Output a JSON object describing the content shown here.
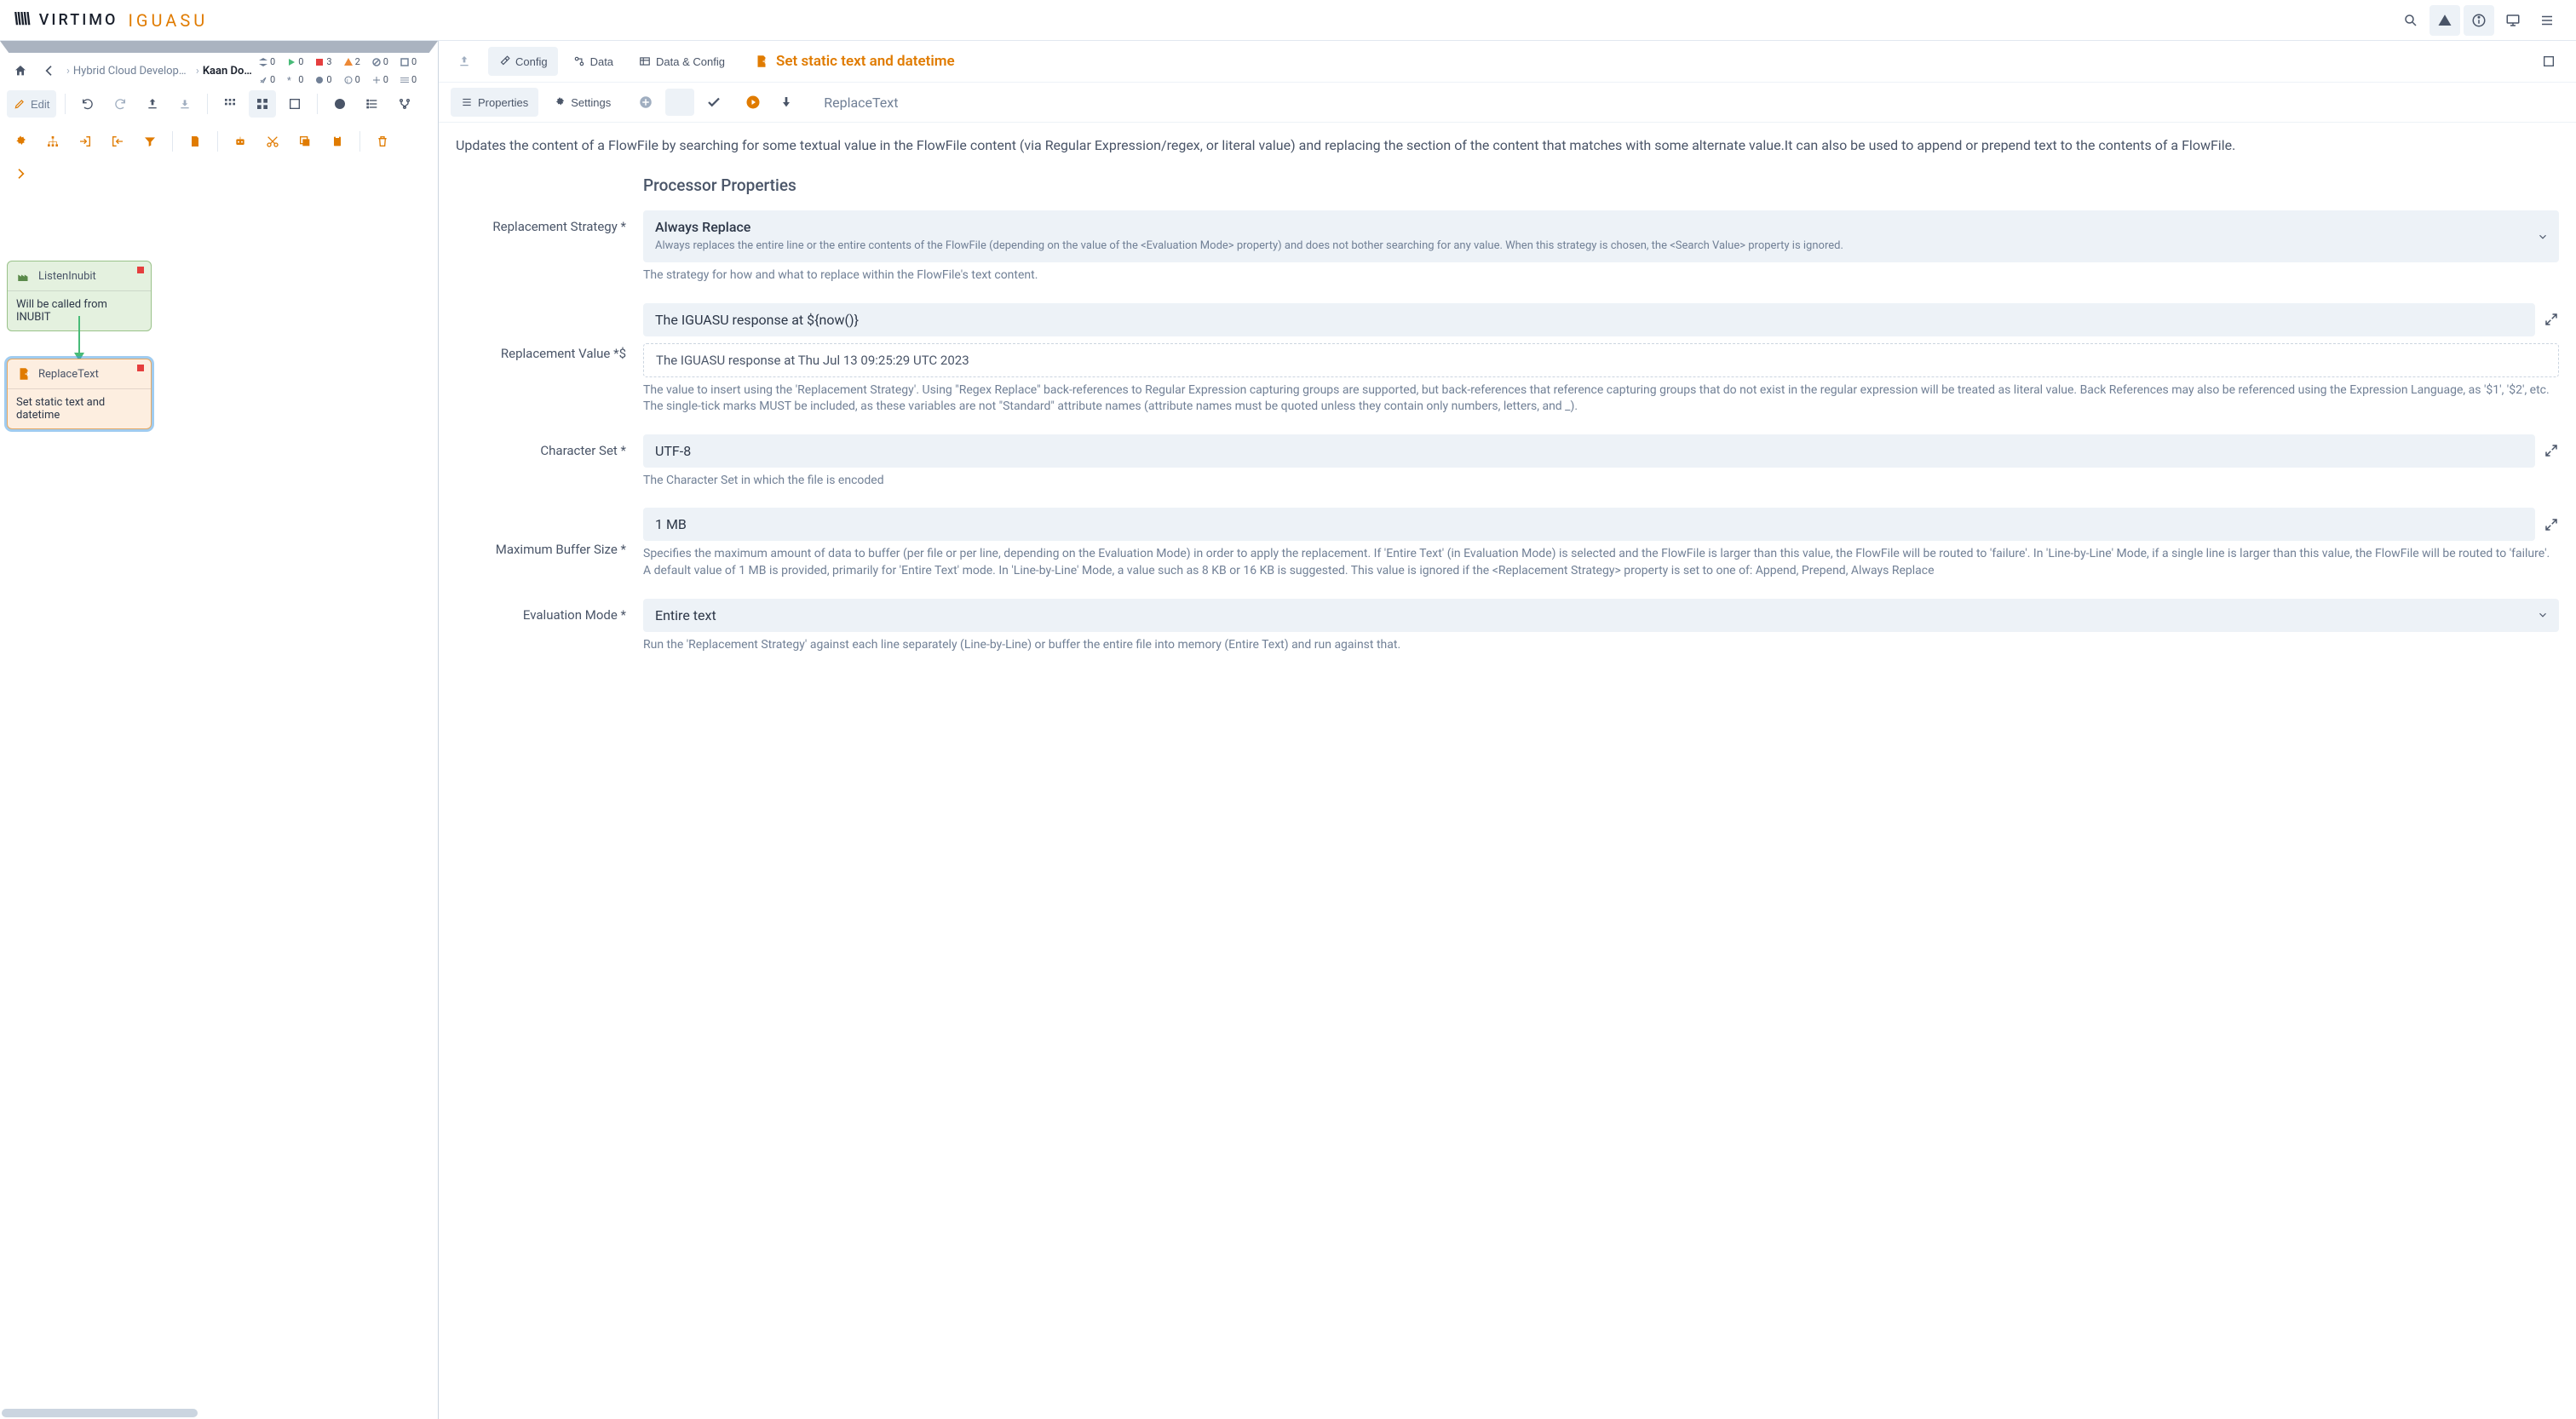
{
  "logo": {
    "brand1": "VIRTIMO",
    "brand2": "IGUASU"
  },
  "breadcrumb": {
    "item1": "Hybrid Cloud Developm...",
    "item2": "Kaan Docs"
  },
  "status": {
    "queued": "0",
    "running": "0",
    "stopped": "3",
    "warning": "2",
    "disabled": "0",
    "valid": "0",
    "sync": "0",
    "info": "0",
    "error": "0",
    "other": "0",
    "count2": "0"
  },
  "toolbar": {
    "edit": "Edit"
  },
  "nodes": {
    "n1": {
      "type": "ListenInubit",
      "desc": "Will be called from INUBIT"
    },
    "n2": {
      "type": "ReplaceText",
      "desc": "Set static text and datetime"
    }
  },
  "rightTabs": {
    "config": "Config",
    "data": "Data",
    "dataConfig": "Data & Config"
  },
  "processorTitle": "Set static text and datetime",
  "rightTabs2": {
    "properties": "Properties",
    "settings": "Settings"
  },
  "processorType": "ReplaceText",
  "description": "Updates the content of a FlowFile by searching for some textual value in the FlowFile content (via Regular Expression/regex, or literal value) and replacing the section of the content that matches with some alternate value.It can also be used to append or prepend text to the contents of a FlowFile.",
  "sectionTitle": "Processor Properties",
  "props": {
    "replacementStrategy": {
      "label": "Replacement Strategy *",
      "valueTitle": "Always Replace",
      "valueSub": "Always replaces the entire line or the entire contents of the FlowFile (depending on the value of the <Evaluation Mode> property) and does not bother searching for any value. When this strategy is chosen, the <Search Value> property is ignored.",
      "hint": "The strategy for how and what to replace within the FlowFile's text content."
    },
    "replacementValue": {
      "label": "Replacement Value *$",
      "value": "The IGUASU response at ${now()}",
      "preview": "The IGUASU response at Thu Jul 13 09:25:29 UTC 2023",
      "hint": "The value to insert using the 'Replacement Strategy'. Using \"Regex Replace\" back-references to Regular Expression capturing groups are supported, but back-references that reference capturing groups that do not exist in the regular expression will be treated as literal value. Back References may also be referenced using the Expression Language, as '$1', '$2', etc. The single-tick marks MUST be included, as these variables are not \"Standard\" attribute names (attribute names must be quoted unless they contain only numbers, letters, and _)."
    },
    "characterSet": {
      "label": "Character Set *",
      "value": "UTF-8",
      "hint": "The Character Set in which the file is encoded"
    },
    "maxBuffer": {
      "label": "Maximum Buffer Size *",
      "value": "1 MB",
      "hint": "Specifies the maximum amount of data to buffer (per file or per line, depending on the Evaluation Mode) in order to apply the replacement. If 'Entire Text' (in Evaluation Mode) is selected and the FlowFile is larger than this value, the FlowFile will be routed to 'failure'. In 'Line-by-Line' Mode, if a single line is larger than this value, the FlowFile will be routed to 'failure'. A default value of 1 MB is provided, primarily for 'Entire Text' mode. In 'Line-by-Line' Mode, a value such as 8 KB or 16 KB is suggested. This value is ignored if the <Replacement Strategy> property is set to one of: Append, Prepend, Always Replace"
    },
    "evalMode": {
      "label": "Evaluation Mode *",
      "value": "Entire text",
      "hint": "Run the 'Replacement Strategy' against each line separately (Line-by-Line) or buffer the entire file into memory (Entire Text) and run against that."
    }
  }
}
